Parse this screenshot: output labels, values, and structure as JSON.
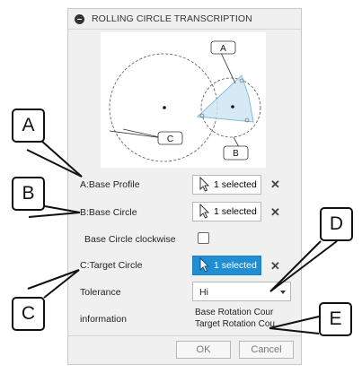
{
  "dialog": {
    "title": "ROLLING CIRCLE TRANSCRIPTION",
    "preview_labels": {
      "a": "A",
      "b": "B",
      "c": "C"
    },
    "rows": {
      "base_profile": {
        "label": "A:Base Profile",
        "button": "1 selected"
      },
      "base_circle": {
        "label": "B:Base Circle",
        "button": "1 selected"
      },
      "clockwise": {
        "label": "Base Circle clockwise"
      },
      "target_circle": {
        "label": "C:Target Circle",
        "button": "1 selected"
      },
      "tolerance": {
        "label": "Tolerance",
        "value": "Hi"
      },
      "information": {
        "label": "information",
        "lines": [
          "Base Rotation Cour",
          "Target Rotation Cou"
        ]
      }
    },
    "ok_label": "OK",
    "cancel_label": "Cancel"
  },
  "callouts": [
    "A",
    "B",
    "C",
    "D",
    "E"
  ],
  "colors": {
    "accent": "#1f8ed3",
    "profile_fill": "#cfe6f4",
    "profile_stroke": "#6bb3dc"
  }
}
